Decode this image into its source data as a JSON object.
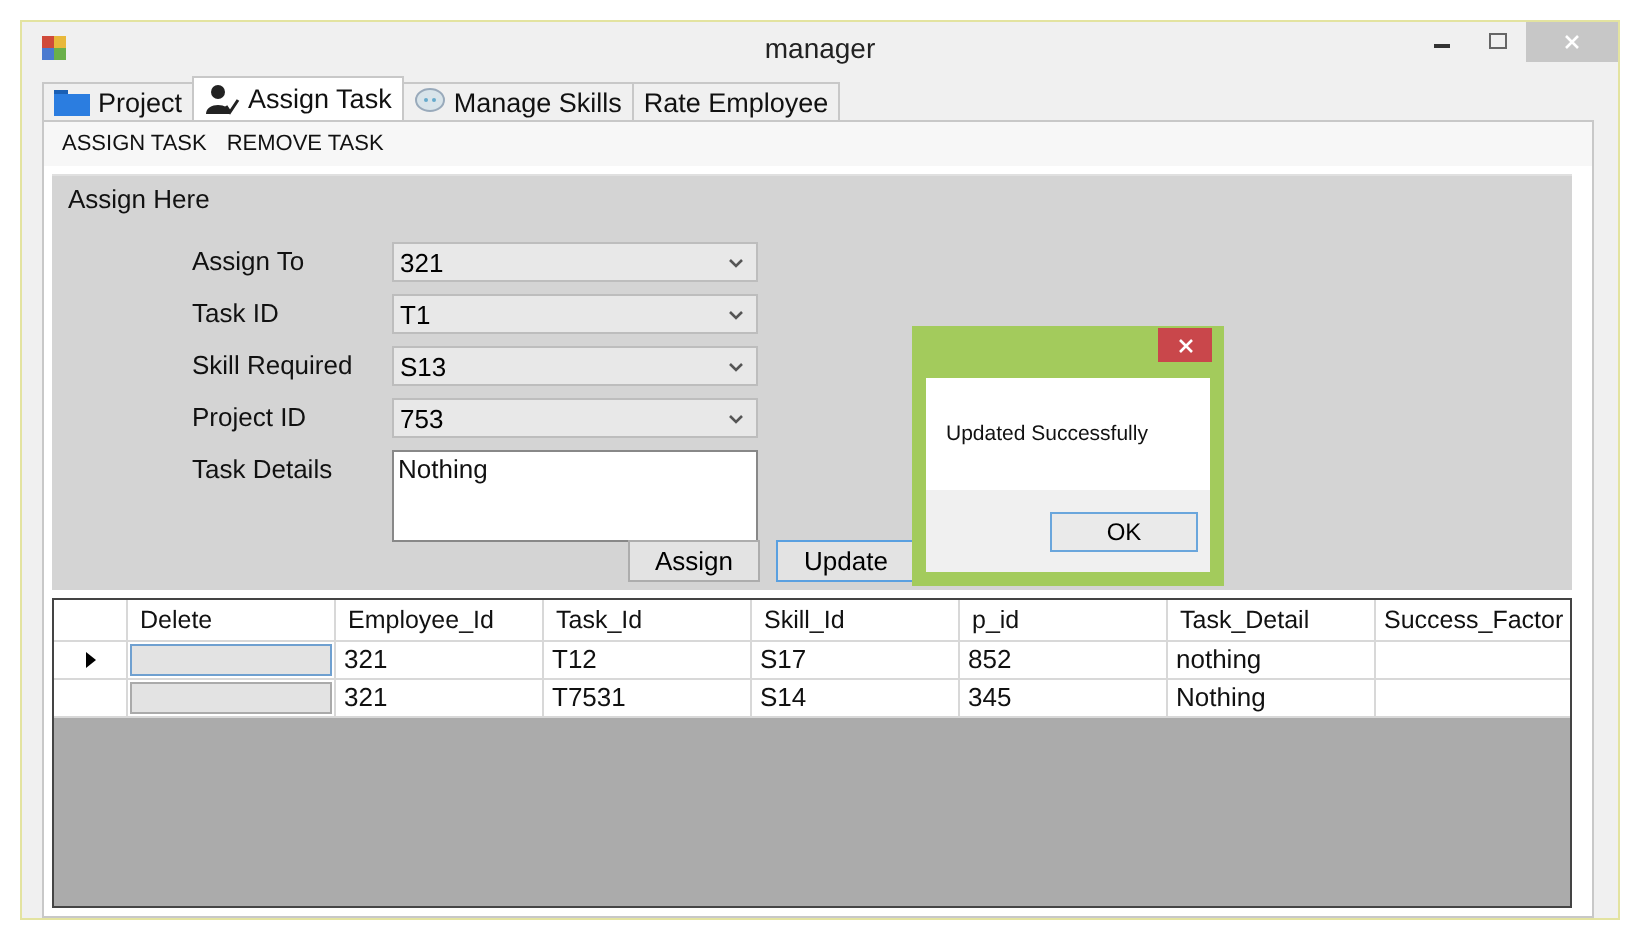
{
  "window": {
    "title": "manager"
  },
  "tabs": [
    {
      "label": "Project",
      "selected": false
    },
    {
      "label": "Assign Task",
      "selected": true
    },
    {
      "label": "Manage Skills",
      "selected": false
    },
    {
      "label": "Rate Employee",
      "selected": false
    }
  ],
  "menu": [
    "ASSIGN TASK",
    "REMOVE TASK"
  ],
  "group": {
    "title": "Assign Here"
  },
  "form": [
    {
      "label": "Assign To",
      "value": "321",
      "kind": "combo"
    },
    {
      "label": "Task ID",
      "value": "T1",
      "kind": "combo"
    },
    {
      "label": "Skill Required",
      "value": "S13",
      "kind": "combo"
    },
    {
      "label": "Project ID",
      "value": "753",
      "kind": "combo"
    },
    {
      "label": "Task Details",
      "value": "Nothing",
      "kind": "textarea"
    }
  ],
  "buttons": [
    {
      "label": "Assign",
      "focused": false
    },
    {
      "label": "Update",
      "focused": true
    }
  ],
  "table": {
    "columns": [
      "Delete",
      "Employee_Id",
      "Task_Id",
      "Skill_Id",
      "p_id",
      "Task_Detail",
      "Success_Factor"
    ],
    "rows": [
      {
        "current": true,
        "cells": [
          "",
          "321",
          "T12",
          "S17",
          "852",
          "nothing",
          ""
        ]
      },
      {
        "current": false,
        "cells": [
          "",
          "321",
          "T7531",
          "S14",
          "345",
          "Nothing",
          ""
        ]
      }
    ]
  },
  "dialog": {
    "message": "Updated Successfully",
    "button": "OK"
  }
}
